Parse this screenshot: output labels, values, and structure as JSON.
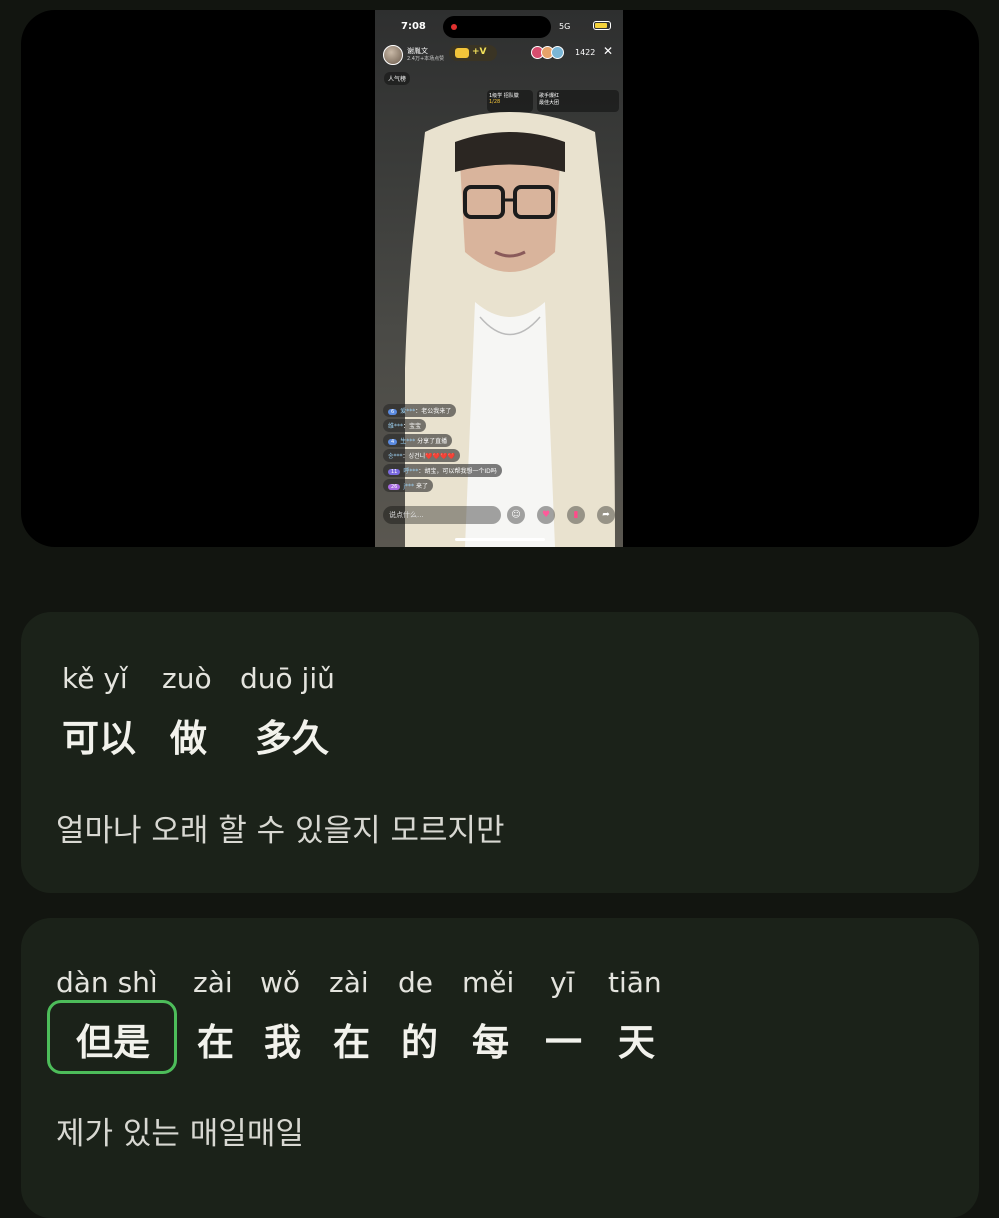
{
  "video": {
    "phone_status": {
      "time": "7:08",
      "network": "5G"
    },
    "host": {
      "name": "谢胤文",
      "sub": "2.4万+本场点赞"
    },
    "badge": "+V",
    "viewer_count": "1422",
    "close_icon": "✕",
    "rank_label": "人气榜",
    "chip1": {
      "line1": "1级学 招队徽",
      "line2": "1/28"
    },
    "chip2": {
      "line1": "歌手爆红",
      "line2": "最佳大团"
    },
    "comments": [
      {
        "level": "6",
        "name": "爱***",
        "text": "老公我来了"
      },
      {
        "level": "",
        "name": "维***",
        "text": "宝宝"
      },
      {
        "level": "4",
        "name": "生***",
        "text": "分享了直播"
      },
      {
        "level": "",
        "name": "송***",
        "text": "싱건니❤️❤️❤️❤️"
      },
      {
        "level": "11",
        "name": "呼***",
        "text": "胡宝，可以帮我想一个ID吗"
      },
      {
        "level": "26",
        "name": "j***",
        "text": "来了"
      }
    ],
    "input_placeholder": "说点什么...",
    "icons": [
      "smile-icon",
      "gift-icon",
      "heart-icon",
      "share-icon"
    ]
  },
  "card1": {
    "segments": [
      {
        "pinyin": "kě yǐ",
        "hanzi": "可以"
      },
      {
        "pinyin": "zuò",
        "hanzi": "做"
      },
      {
        "pinyin": "duō jiǔ",
        "hanzi": "多久"
      }
    ],
    "translation": "얼마나 오래 할 수 있을지 모르지만"
  },
  "card2": {
    "segments": [
      {
        "pinyin": "dàn shì",
        "hanzi": "但是",
        "highlighted": true
      },
      {
        "pinyin": "zài",
        "hanzi": "在"
      },
      {
        "pinyin": "wǒ",
        "hanzi": "我"
      },
      {
        "pinyin": "zài",
        "hanzi": "在"
      },
      {
        "pinyin": "de",
        "hanzi": "的"
      },
      {
        "pinyin": "měi",
        "hanzi": "每"
      },
      {
        "pinyin": "yī",
        "hanzi": "一"
      },
      {
        "pinyin": "tiān",
        "hanzi": "天"
      }
    ],
    "translation": "제가 있는 매일매일",
    "highlight_color": "#4dbd5a"
  }
}
